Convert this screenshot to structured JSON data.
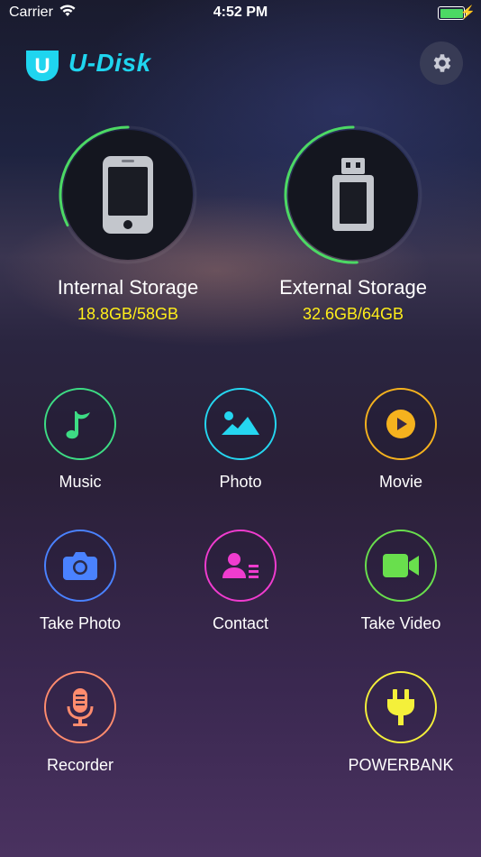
{
  "status_bar": {
    "carrier": "Carrier",
    "time": "4:52 PM"
  },
  "header": {
    "app_name": "U-Disk",
    "logo_letter": "U"
  },
  "storage": [
    {
      "label": "Internal Storage",
      "usage": "18.8GB/58GB",
      "used_fraction": 0.324
    },
    {
      "label": "External Storage",
      "usage": "32.6GB/64GB",
      "used_fraction": 0.509
    }
  ],
  "features": [
    {
      "label": "Music",
      "icon": "music-note-icon",
      "color": "#3ddc84"
    },
    {
      "label": "Photo",
      "icon": "picture-icon",
      "color": "#25d6f0"
    },
    {
      "label": "Movie",
      "icon": "play-icon",
      "color": "#f5b21e"
    },
    {
      "label": "Take Photo",
      "icon": "camera-icon",
      "color": "#4a82ff"
    },
    {
      "label": "Contact",
      "icon": "contact-card-icon",
      "color": "#f03ccf"
    },
    {
      "label": "Take Video",
      "icon": "video-camera-icon",
      "color": "#69df4d"
    },
    {
      "label": "Recorder",
      "icon": "microphone-icon",
      "color": "#ff8c6e"
    },
    {
      "label": "POWERBANK",
      "icon": "plug-icon",
      "color": "#f4f03a"
    }
  ],
  "colors": {
    "accent": "#1fd5ef",
    "usage_text": "#ffee1a",
    "ring": "#4cd964"
  }
}
